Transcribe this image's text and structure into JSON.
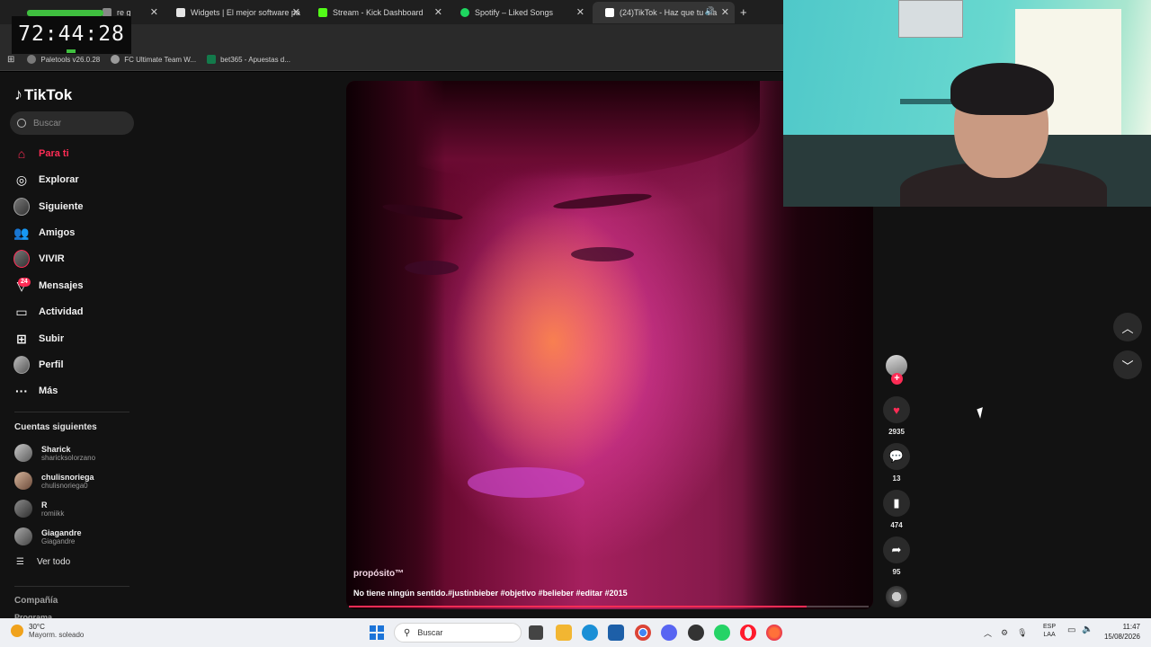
{
  "browser": {
    "tabs": [
      {
        "label": "re g",
        "favicon_color": "#888888"
      },
      {
        "label": "Widgets | El mejor software pa",
        "favicon_color": "#e5e5e5"
      },
      {
        "label": "Stream - Kick Dashboard",
        "favicon_color": "#53fc18"
      },
      {
        "label": "Spotify – Liked Songs",
        "favicon_color": "#1ed760"
      },
      {
        "label": "(24)TikTok - Haz que tu día",
        "favicon_color": "#ffffff",
        "active": true
      }
    ],
    "new_tab": "+",
    "bookmarks": [
      {
        "label": "Paletools v26.0.28",
        "color": "#7a7a7a"
      },
      {
        "label": "FC Ultimate Team W...",
        "color": "#9a9a9a"
      },
      {
        "label": "bet365 - Apuestas d...",
        "color": "#137a4b"
      }
    ]
  },
  "timer": {
    "value": "72:44:28"
  },
  "tiktok": {
    "logo": "TikTok",
    "search_placeholder": "Buscar",
    "nav": [
      {
        "label": "Para ti",
        "icon": "home-icon",
        "active": true
      },
      {
        "label": "Explorar",
        "icon": "compass-icon"
      },
      {
        "label": "Siguiente",
        "icon": "following-avatar-icon"
      },
      {
        "label": "Amigos",
        "icon": "friends-icon"
      },
      {
        "label": "VIVIR",
        "icon": "live-icon"
      },
      {
        "label": "Mensajes",
        "icon": "messages-icon",
        "badge": "24"
      },
      {
        "label": "Actividad",
        "icon": "activity-icon"
      },
      {
        "label": "Subir",
        "icon": "upload-icon"
      },
      {
        "label": "Perfil",
        "icon": "profile-icon"
      },
      {
        "label": "Más",
        "icon": "more-icon"
      }
    ],
    "following_heading": "Cuentas siguientes",
    "following": [
      {
        "name": "Sharick",
        "handle": "sharicksolorzano"
      },
      {
        "name": "chulisnoriega",
        "handle": "chulisnoriega0"
      },
      {
        "name": "R",
        "handle": "romiikk"
      },
      {
        "name": "Giagandre",
        "handle": "Giagandre"
      }
    ],
    "see_all": "Ver todo",
    "footer_company": "Compañía",
    "footer_program": "Programa",
    "video": {
      "title": "propósito™",
      "description": "No tiene ningún sentido.#justinbieber #objetivo #belieber #editar #2015",
      "progress": 0.88
    },
    "actions": {
      "likes": "2935",
      "comments": "13",
      "saves": "474",
      "shares": "95"
    }
  },
  "taskbar": {
    "weather_temp": "30°C",
    "weather_desc": "Mayorm. soleado",
    "search_placeholder": "Buscar",
    "lang_line1": "ESP",
    "lang_line2": "LAA",
    "time": "11:47",
    "date": "15/08/2026"
  }
}
